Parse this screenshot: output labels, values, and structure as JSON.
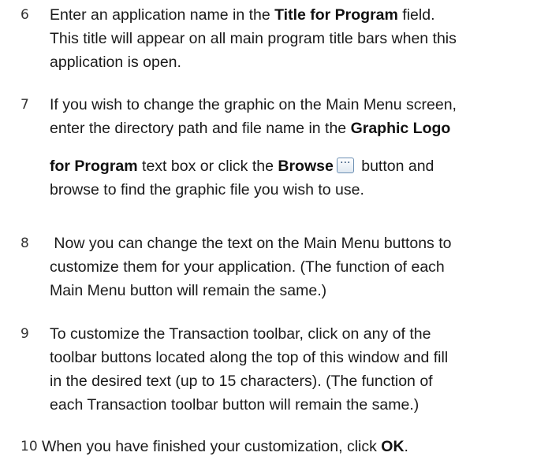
{
  "steps": [
    {
      "number": "6",
      "l1_a": "Enter an application name in the ",
      "l1_b": "Title for Program",
      "l1_c": " field.",
      "l2": "This title will appear on all main program title bars when this",
      "l3": "application is open."
    },
    {
      "number": "7",
      "l1": "If you wish to change the graphic on the Main Menu screen,",
      "l2_a": "enter the directory path and file name in the ",
      "l2_b": "Graphic Logo",
      "l3_a": "for Program",
      "l3_b": " text box or click the ",
      "l3_c": "Browse",
      "l3_d": " button and",
      "l4": "browse to find the graphic file you wish to use.",
      "browse_icon": "ellipsis-browse-icon"
    },
    {
      "number": "8",
      "l1": " Now you can change the text on the Main Menu buttons to",
      "l2": "customize them for your application. (The function of each",
      "l3": "Main Menu button will remain the same.)"
    },
    {
      "number": "9",
      "l1": "To customize the Transaction toolbar, click on any of the",
      "l2": "toolbar buttons located along the top of this window and fill",
      "l3": "in the desired text (up to 15 characters). (The function of",
      "l4": "each Transaction toolbar button will remain the same.)"
    },
    {
      "number": "10",
      "l1_a": "When you have finished your customization, click ",
      "l1_b": "OK",
      "l1_c": "."
    }
  ]
}
